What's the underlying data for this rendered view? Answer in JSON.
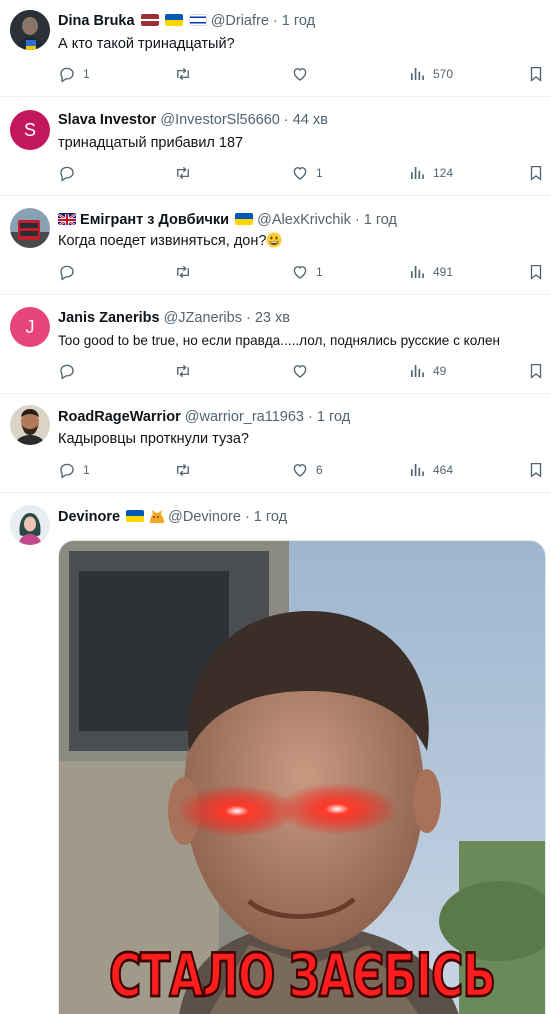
{
  "tweets": [
    {
      "name": "Dina Bruka",
      "flags": [
        "latvia",
        "ukraine",
        "israel"
      ],
      "handle": "@Driafre",
      "time": "· 1 год",
      "text": "А кто такой тринадцатый?",
      "replies": "1",
      "retweets": "",
      "likes": "",
      "views": "570",
      "avatar": "photo-dark"
    },
    {
      "name": "Slava Investor",
      "flags": [],
      "handle": "@InvestorSl56660",
      "time": "· 44 хв",
      "text": "тринадцатый прибавил 187",
      "replies": "",
      "retweets": "",
      "likes": "1",
      "views": "124",
      "avatar": "letter",
      "avatar_letter": "S",
      "avatar_color": "#c2185b"
    },
    {
      "name": "Емігрант з Довбички",
      "flags_before": [
        "uk"
      ],
      "flags": [
        "ukraine"
      ],
      "handle": "@AlexKrivchik",
      "time": "· 1 год",
      "text": "Когда поедет извиняться, дон?",
      "emoji": "grinning-face",
      "replies": "",
      "retweets": "",
      "likes": "1",
      "views": "491",
      "avatar": "photo-bus"
    },
    {
      "name": "Janis Zaneribs",
      "flags": [],
      "handle": "@JZaneribs",
      "time": "· 23 хв",
      "text": "Too good to be true, но если правда.....лол, поднялись русские с колен",
      "replies": "",
      "retweets": "",
      "likes": "",
      "views": "49",
      "avatar": "letter",
      "avatar_letter": "J",
      "avatar_color": "#e8457a"
    },
    {
      "name": "RoadRageWarrior",
      "flags": [],
      "handle": "@warrior_ra11963",
      "time": "· 1 год",
      "text": "Кадыровцы проткнули туза?",
      "replies": "1",
      "retweets": "",
      "likes": "6",
      "views": "464",
      "avatar": "photo-man"
    },
    {
      "name": "Devinore",
      "flags": [
        "ukraine"
      ],
      "emoji_after_flags": "cat",
      "handle": "@Devinore",
      "time": "· 1 год",
      "avatar": "photo-woman",
      "media_caption": "СТАЛО ЗАЄБІСЬ"
    }
  ],
  "icons": {
    "reply": "reply-icon",
    "retweet": "retweet-icon",
    "like": "heart-icon",
    "views": "views-icon",
    "bookmark": "bookmark-icon"
  },
  "colors": {
    "secondary_text": "#536471",
    "divider": "#eff3f4",
    "meme_text": "#ff1e1e"
  }
}
